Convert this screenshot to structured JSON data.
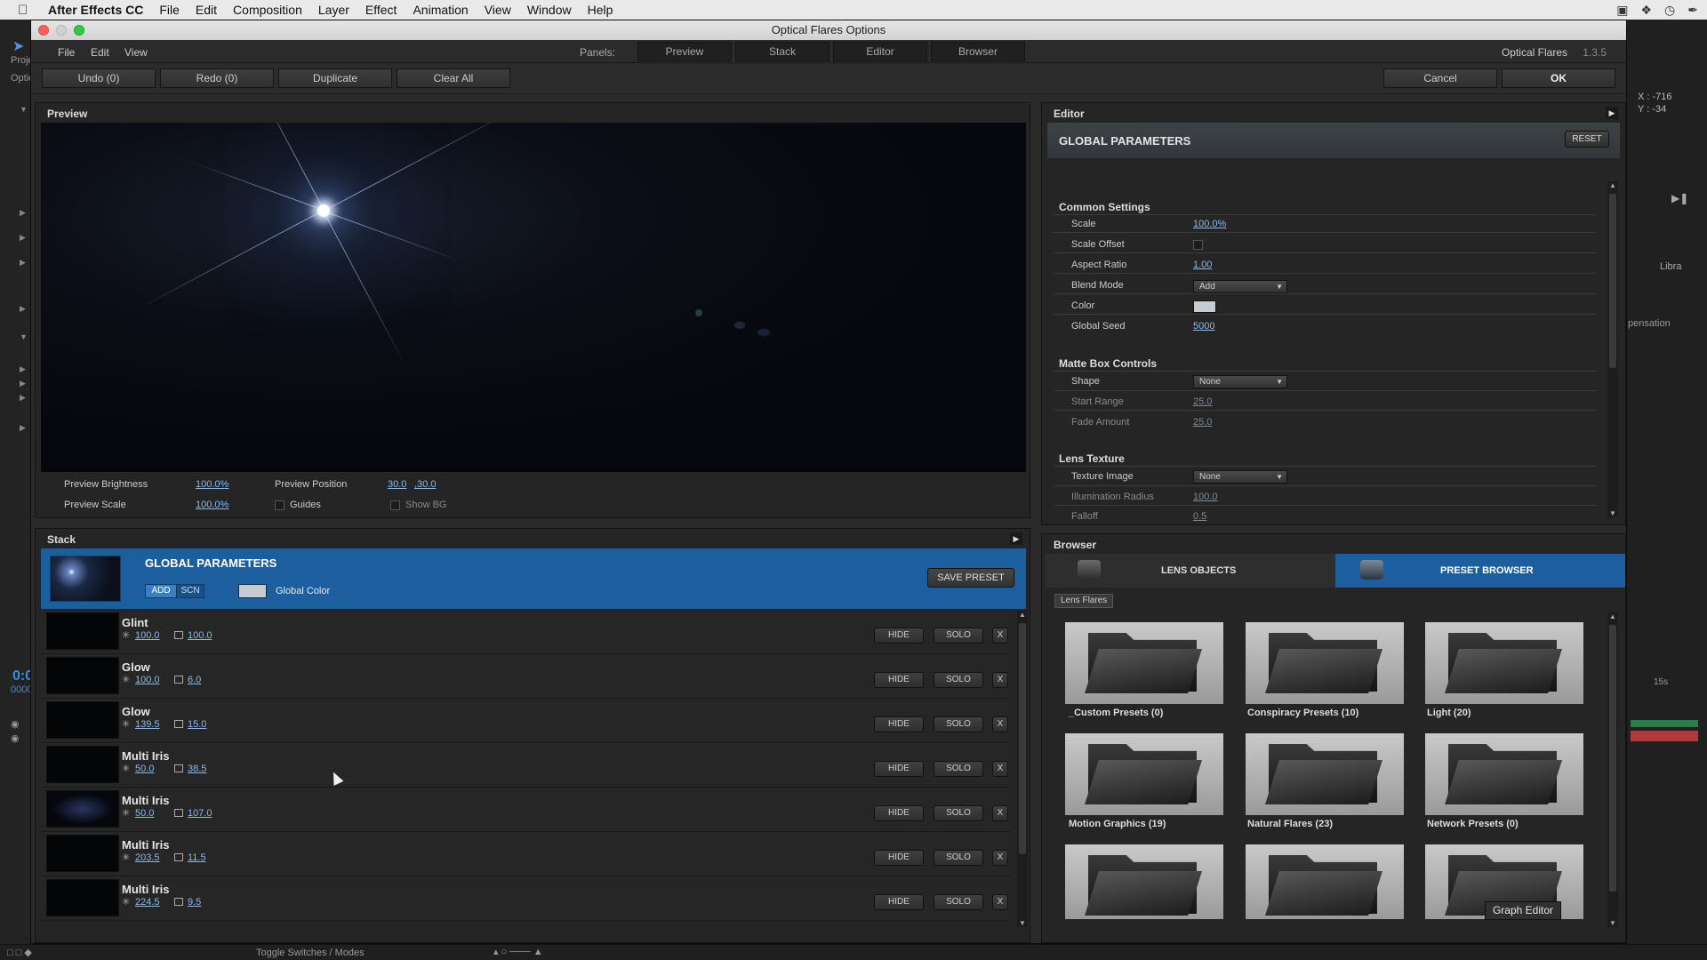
{
  "menubar": {
    "app_name": "After Effects CC",
    "items": [
      "File",
      "Edit",
      "Composition",
      "Layer",
      "Effect",
      "Animation",
      "View",
      "Window",
      "Help"
    ]
  },
  "ae_background": {
    "left_labels": [
      "Proje",
      "Optica"
    ],
    "coords": {
      "x": "X : -716",
      "y": "Y : -34"
    },
    "libra": "Libra",
    "compensation": "pensation",
    "timecode": "0:0",
    "timecode_sub": "0000",
    "time_marker": "15s",
    "toggle_switches": "Toggle Switches / Modes"
  },
  "dialog": {
    "title": "Optical Flares Options",
    "menu": [
      "File",
      "Edit",
      "View"
    ],
    "panels_label": "Panels:",
    "panel_tabs": [
      "Preview",
      "Stack",
      "Editor",
      "Browser"
    ],
    "product": "Optical Flares",
    "version": "1.3.5",
    "undo": "Undo (0)",
    "redo": "Redo (0)",
    "duplicate": "Duplicate",
    "clear_all": "Clear All",
    "cancel": "Cancel",
    "ok": "OK"
  },
  "preview": {
    "title": "Preview",
    "brightness_label": "Preview Brightness",
    "brightness_value": "100.0%",
    "scale_label": "Preview Scale",
    "scale_value": "100.0%",
    "position_label": "Preview Position",
    "position_x": "30.0",
    "position_y": ",30.0",
    "guides_label": "Guides",
    "show_bg_label": "Show BG"
  },
  "stack": {
    "title": "Stack",
    "global": {
      "title": "GLOBAL PARAMETERS",
      "add": "ADD",
      "scn": "SCN",
      "global_color_label": "Global Color",
      "save_preset": "SAVE PRESET"
    },
    "rows": [
      {
        "name": "Glint",
        "brightness": "100.0",
        "scale": "100.0"
      },
      {
        "name": "Glow",
        "brightness": "100.0",
        "scale": "6.0"
      },
      {
        "name": "Glow",
        "brightness": "139.5",
        "scale": "15.0"
      },
      {
        "name": "Multi Iris",
        "brightness": "50.0",
        "scale": "38.5"
      },
      {
        "name": "Multi Iris",
        "brightness": "50.0",
        "scale": "107.0"
      },
      {
        "name": "Multi Iris",
        "brightness": "203.5",
        "scale": "11.5"
      },
      {
        "name": "Multi Iris",
        "brightness": "224.5",
        "scale": "9.5"
      }
    ],
    "hide_label": "HIDE",
    "solo_label": "SOLO",
    "delete_label": "X"
  },
  "editor": {
    "title": "Editor",
    "header": "GLOBAL PARAMETERS",
    "reset": "RESET",
    "common_settings": {
      "title": "Common Settings",
      "scale_label": "Scale",
      "scale_value": "100.0%",
      "scale_offset_label": "Scale Offset",
      "aspect_label": "Aspect Ratio",
      "aspect_value": "1.00",
      "blend_label": "Blend Mode",
      "blend_value": "Add",
      "color_label": "Color",
      "seed_label": "Global Seed",
      "seed_value": "5000"
    },
    "matte_box": {
      "title": "Matte Box Controls",
      "shape_label": "Shape",
      "shape_value": "None",
      "start_label": "Start Range",
      "start_value": "25.0",
      "fade_label": "Fade Amount",
      "fade_value": "25.0"
    },
    "lens_texture": {
      "title": "Lens Texture",
      "texture_label": "Texture Image",
      "texture_value": "None",
      "radius_label": "Illumination Radius",
      "radius_value": "100.0",
      "falloff_label": "Falloff",
      "falloff_value": "0.5"
    }
  },
  "browser": {
    "title": "Browser",
    "tab_lens_objects": "LENS OBJECTS",
    "tab_preset_browser": "PRESET BROWSER",
    "breadcrumb": "Lens Flares",
    "folders": [
      {
        "name": "_Custom Presets (0)"
      },
      {
        "name": "Conspiracy Presets (10)"
      },
      {
        "name": "Light (20)"
      },
      {
        "name": "Motion Graphics (19)"
      },
      {
        "name": "Natural Flares (23)"
      },
      {
        "name": "Network Presets (0)"
      },
      {
        "name": ""
      },
      {
        "name": ""
      },
      {
        "name": ""
      }
    ],
    "tooltip": "Graph Editor"
  }
}
